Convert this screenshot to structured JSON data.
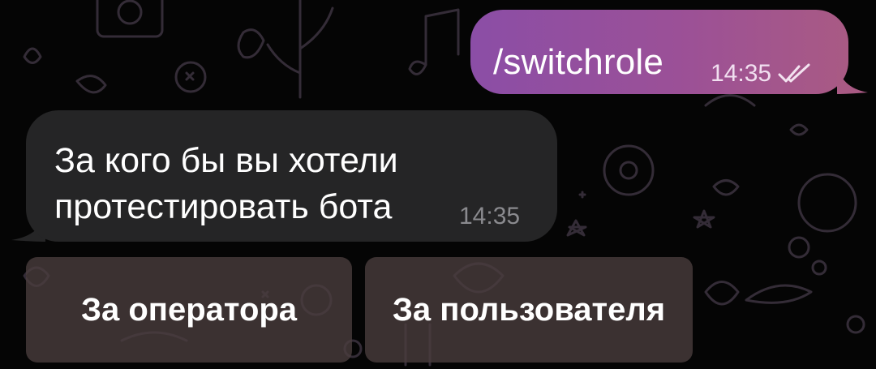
{
  "chat": {
    "background_pattern": "doodle-pattern",
    "messages": [
      {
        "direction": "outgoing",
        "text": "/switchrole",
        "time": "14:35",
        "status_icon": "double-check-icon",
        "bubble_color": "#9b5097"
      },
      {
        "direction": "incoming",
        "text_lines": [
          "За кого бы вы хотели",
          "протестировать бота"
        ],
        "time": "14:35",
        "bubble_color": "#252526"
      }
    ],
    "inline_keyboard": [
      {
        "label": "За оператора"
      },
      {
        "label": "За пользователя"
      }
    ]
  }
}
